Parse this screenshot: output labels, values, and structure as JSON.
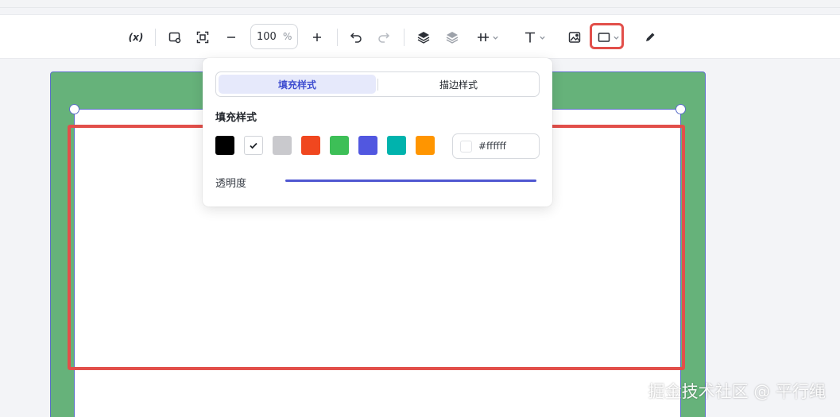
{
  "toolbar": {
    "variable_label": "(x)",
    "zoom_value": "100",
    "zoom_unit": "%",
    "icons": [
      "variable-icon",
      "frame-icon",
      "fit-screen-icon",
      "zoom-out-icon",
      "zoom-in-icon",
      "undo-icon",
      "redo-icon",
      "bring-forward-icon",
      "send-backward-icon",
      "align-icon",
      "text-icon",
      "image-icon",
      "rectangle-icon",
      "pen-icon"
    ]
  },
  "popup": {
    "tabs": [
      {
        "label": "填充样式",
        "active": true
      },
      {
        "label": "描边样式",
        "active": false
      }
    ],
    "section_title": "填充样式",
    "colors": [
      "#000000",
      "#ffffff",
      "#c9c9cd",
      "#f0471f",
      "#3dbf57",
      "#5157e0",
      "#00b3ad",
      "#ff9500"
    ],
    "selected_color_index": 1,
    "hex_value": "#ffffff",
    "opacity_label": "透明度",
    "opacity_value": 1.0
  },
  "colors": {
    "canvas_bg": "#66b27a",
    "accent": "#4f57d1",
    "highlight": "#e24f4a"
  },
  "watermark": "掘金技术社区 @ 平行绳"
}
